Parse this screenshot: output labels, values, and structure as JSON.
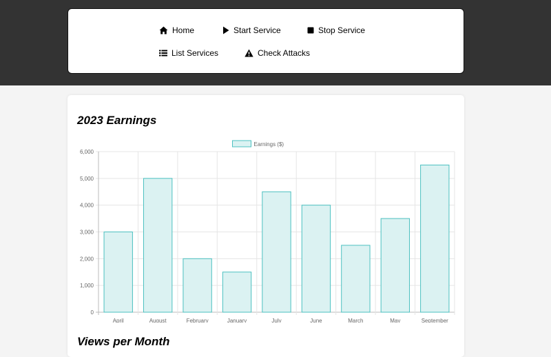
{
  "nav": {
    "items": [
      {
        "label": "Home",
        "icon": "home-icon"
      },
      {
        "label": "Start Service",
        "icon": "play-icon"
      },
      {
        "label": "Stop Service",
        "icon": "stop-icon"
      },
      {
        "label": "List Services",
        "icon": "list-icon"
      },
      {
        "label": "Check Attacks",
        "icon": "warning-icon"
      }
    ]
  },
  "sections": {
    "earnings_title": "2023 Earnings",
    "views_title": "Views per Month"
  },
  "chart_data": {
    "type": "bar",
    "categories": [
      "April",
      "August",
      "February",
      "January",
      "July",
      "June",
      "March",
      "May",
      "September"
    ],
    "series": [
      {
        "name": "Earnings ($)",
        "values": [
          3000,
          5000,
          2000,
          1500,
          4500,
          4000,
          2500,
          3500,
          5500
        ],
        "fill": "#dbf2f2",
        "stroke": "#4bc0c0"
      }
    ],
    "yticks": [
      "0",
      "1,000",
      "2,000",
      "3,000",
      "4,000",
      "5,000",
      "6,000"
    ],
    "ylim": [
      0,
      6000
    ],
    "legend": "top-center",
    "grid": true
  }
}
